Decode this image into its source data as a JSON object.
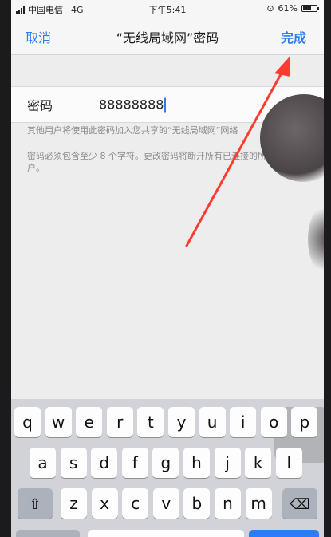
{
  "status_bar": {
    "carrier": "中国电信",
    "network": "4G",
    "time": "下午5:41",
    "battery_percent": "61%",
    "battery_level": 0.61
  },
  "nav": {
    "cancel_label": "取消",
    "title": "“无线局域网”密码",
    "done_label": "完成"
  },
  "form": {
    "password_label": "密码",
    "password_value": "88888888",
    "note_share": "其他用户将使用此密码加入您共享的“无线局域网”网络",
    "note_requirement": "密码必须包含至少 8 个字符。更改密码将断开所有已连接的所有用户。"
  },
  "keyboard": {
    "row1": [
      "q",
      "w",
      "e",
      "r",
      "t",
      "y",
      "u",
      "i",
      "o",
      "p"
    ],
    "row2": [
      "a",
      "s",
      "d",
      "f",
      "g",
      "h",
      "j",
      "k",
      "l"
    ],
    "row3": [
      "z",
      "x",
      "c",
      "v",
      "b",
      "n",
      "m"
    ],
    "shift_icon": "shift-icon",
    "delete_icon": "backspace-icon"
  },
  "colors": {
    "accent": "#2d7cf6",
    "annotation_arrow": "#ff3b2f"
  }
}
